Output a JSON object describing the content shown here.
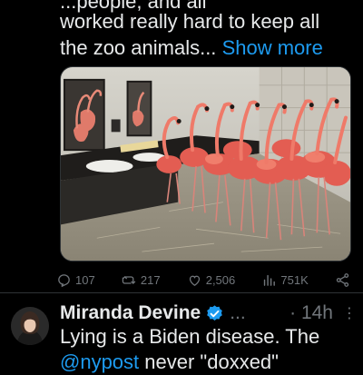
{
  "tweet": {
    "text_top_partial": "...people, and all",
    "text_line1": "worked really hard to keep all",
    "text_line2": "the zoo animals...",
    "show_more": "Show more",
    "replies": "107",
    "retweets": "217",
    "likes": "2,506",
    "views": "751K"
  },
  "reply": {
    "name": "Miranda Devine",
    "handle": "...",
    "time": "· 14h",
    "more": "⋮",
    "text_line1": "Lying is a Biden disease. The",
    "text_line2_mention": "@nypost",
    "text_line2_rest": " never \"doxxed\""
  },
  "colors": {
    "accent": "#1d9bf0",
    "muted": "#71767b",
    "background": "#000000"
  }
}
